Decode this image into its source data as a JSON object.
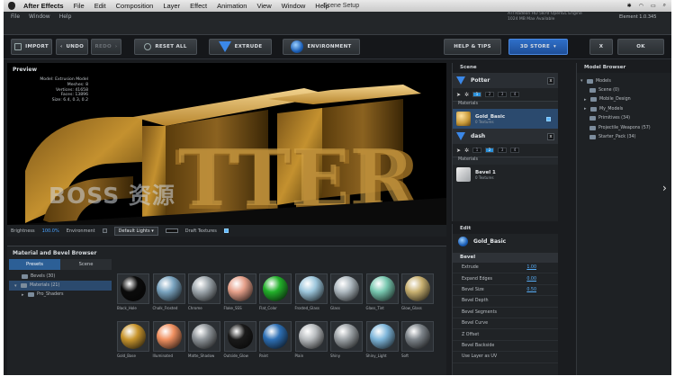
{
  "macbar": {
    "app": "After Effects",
    "menus": [
      "File",
      "Edit",
      "Composition",
      "Layer",
      "Effect",
      "Animation",
      "View",
      "Window",
      "Help"
    ],
    "window_title": "Scene Setup"
  },
  "plugin": {
    "menus": [
      "File",
      "Window",
      "Help"
    ],
    "gpu_line1": "ATI Radeon HD 5870 OpenGL Engine",
    "gpu_line2": "1024 MB Max Available",
    "element_label": "Element  1.0.345"
  },
  "toolbar": {
    "import": "IMPORT",
    "undo": "UNDO",
    "redo": "REDO",
    "reset_all": "RESET ALL",
    "extrude": "EXTRUDE",
    "environment": "ENVIRONMENT",
    "help_tips": "HELP & TIPS",
    "store": "3D STORE",
    "x": "X",
    "ok": "OK"
  },
  "preview": {
    "title": "Preview",
    "stats": [
      "Model: Extrusion Model",
      "Meshes: 8",
      "Vertices: 41658",
      "Faces: 13896",
      "Size: 6.4, 0.3, 0.2"
    ],
    "watermark": "BOSS 资源",
    "brightness_label": "Brightness",
    "brightness_value": "100.0%",
    "environment_label": "Environment",
    "lights_value": "Default Lights",
    "draft_label": "Draft Textures",
    "draft_enabled": true
  },
  "scene": {
    "title": "Scene",
    "objects": [
      {
        "name": "Potter",
        "materials_label": "Materials",
        "material": "Gold_Basic",
        "material_sub": "0 Textures",
        "material_color": "#c89a3a"
      },
      {
        "name": "dash",
        "materials_label": "Materials",
        "material": "Bevel 1",
        "material_sub": "0 Textures",
        "material_color": "#cfd2d4"
      }
    ],
    "tool_numbers": [
      "1",
      "2",
      "3",
      "4"
    ]
  },
  "edit": {
    "title": "Edit",
    "material": "Gold_Basic",
    "bevel_title": "Bevel",
    "props": [
      {
        "label": "Extrude",
        "value": "1.00"
      },
      {
        "label": "Expand Edges",
        "value": "0.00"
      },
      {
        "label": "Bevel Size",
        "value": "0.50"
      },
      {
        "label": "Bevel Depth",
        "value": ""
      },
      {
        "label": "Bevel Segments",
        "value": ""
      },
      {
        "label": "Bevel Curve",
        "value": ""
      },
      {
        "label": "Z Offset",
        "value": ""
      },
      {
        "label": "Bevel Backside",
        "value": ""
      },
      {
        "label": "Use Layer as UV",
        "value": ""
      }
    ]
  },
  "model_browser": {
    "title": "Model Browser",
    "items": [
      "Models",
      "Scene (0)",
      "Mobile_Design",
      "My_Models",
      "Primitives (34)",
      "Projectile_Weapons (57)",
      "Starter_Pack (34)"
    ]
  },
  "material_browser": {
    "title": "Material and Bevel Browser",
    "tabs": [
      "Presets",
      "Scene"
    ],
    "tree": [
      "Bevels (30)",
      "Materials (21)",
      "Pro_Shaders"
    ],
    "materials": [
      {
        "name": "Black_Hole",
        "color": "#0b0b0b"
      },
      {
        "name": "Chalk_Frosted",
        "color": "#7aa4c0"
      },
      {
        "name": "Chrome",
        "color": "#9ea7ad"
      },
      {
        "name": "Flake_SSS",
        "color": "#e6a08a"
      },
      {
        "name": "Flat_Color",
        "color": "#22b02a"
      },
      {
        "name": "Frosted_Glass",
        "color": "#9cc6dc"
      },
      {
        "name": "Glass",
        "color": "#aeb9c0"
      },
      {
        "name": "Glass_Tint",
        "color": "#78c8b0"
      },
      {
        "name": "Glow_Glass",
        "color": "#c8b070"
      },
      {
        "name": "Gold_Base",
        "color": "#c9962e"
      },
      {
        "name": "Illuminated",
        "color": "#f09060"
      },
      {
        "name": "Matte_Shadow",
        "color": "#8e9499"
      },
      {
        "name": "Outside_Glow",
        "color": "#1a1a1a"
      },
      {
        "name": "Paint",
        "color": "#2d6fb4"
      },
      {
        "name": "Plain",
        "color": "#b8bcbf"
      },
      {
        "name": "Shiny",
        "color": "#9ca2a6"
      },
      {
        "name": "Shiny_Light",
        "color": "#7eb6da"
      },
      {
        "name": "Soft",
        "color": "#7d848a"
      }
    ]
  }
}
